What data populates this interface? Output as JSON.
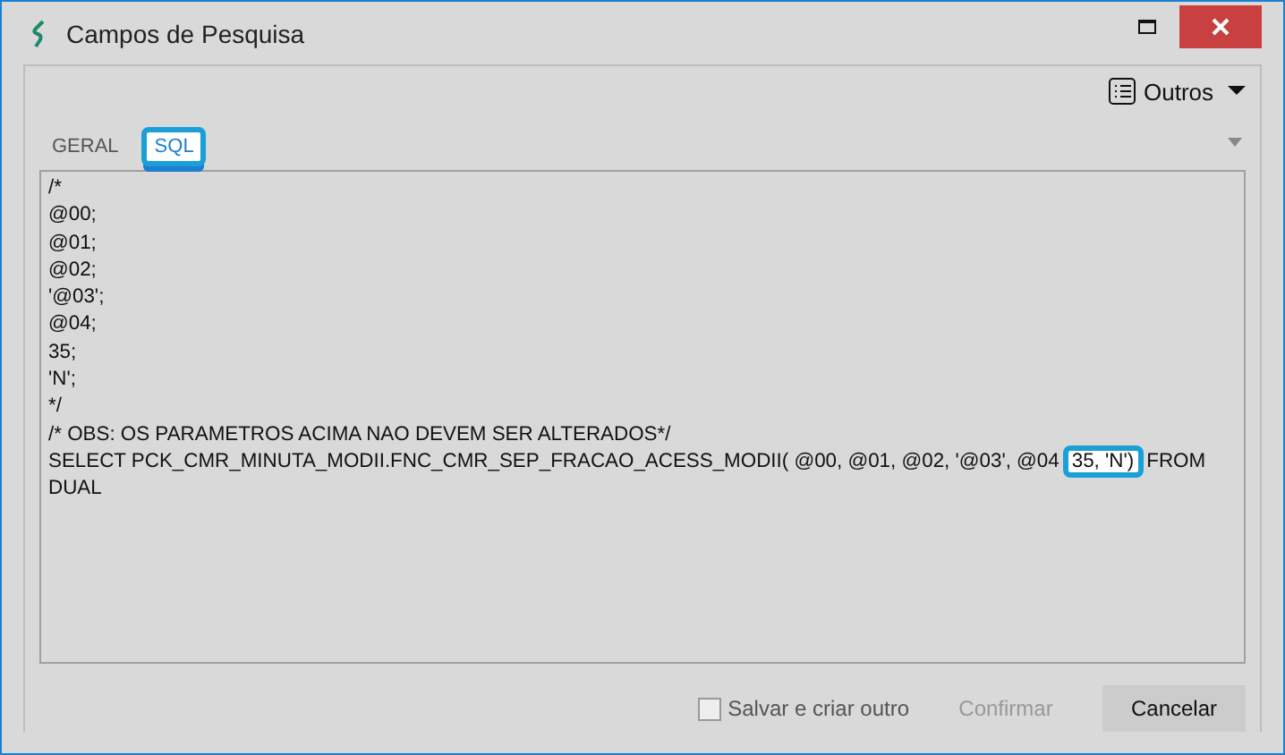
{
  "window": {
    "title": "Campos de Pesquisa"
  },
  "toolbar": {
    "menu_label": "Outros"
  },
  "tabs": [
    {
      "label": "GERAL",
      "selected": false
    },
    {
      "label": "SQL",
      "selected": true
    }
  ],
  "sql_lines": [
    {
      "segments": [
        {
          "text": "/*",
          "highlighted": false
        }
      ]
    },
    {
      "segments": [
        {
          "text": "@00;",
          "highlighted": false
        }
      ]
    },
    {
      "segments": [
        {
          "text": "@01;",
          "highlighted": false
        }
      ]
    },
    {
      "segments": [
        {
          "text": "@02;",
          "highlighted": false
        }
      ]
    },
    {
      "segments": [
        {
          "text": "'@03';",
          "highlighted": false
        }
      ]
    },
    {
      "segments": [
        {
          "text": "@04;",
          "highlighted": false
        }
      ]
    },
    {
      "segments": [
        {
          "text": "35;",
          "highlighted": false
        }
      ]
    },
    {
      "segments": [
        {
          "text": "'N';",
          "highlighted": false
        }
      ]
    },
    {
      "segments": [
        {
          "text": "*/",
          "highlighted": false
        }
      ]
    },
    {
      "segments": [
        {
          "text": "/* OBS: OS PARAMETROS ACIMA NAO DEVEM SER ALTERADOS*/",
          "highlighted": false
        }
      ]
    },
    {
      "segments": [
        {
          "text": "SELECT PCK_CMR_MINUTA_MODII.FNC_CMR_SEP_FRACAO_ACESS_MODII( @00, @01, @02, '@03', @04",
          "highlighted": false
        },
        {
          "text": "35, 'N')",
          "highlighted": true
        },
        {
          "text": "FROM",
          "highlighted": false
        }
      ]
    },
    {
      "segments": [
        {
          "text": "DUAL",
          "highlighted": false
        }
      ]
    }
  ],
  "footer": {
    "checkbox": {
      "label": "Salvar e criar outro",
      "checked": false
    },
    "buttons": [
      {
        "label": "Confirmar",
        "disabled": true
      },
      {
        "label": "Cancelar",
        "disabled": false
      }
    ]
  }
}
